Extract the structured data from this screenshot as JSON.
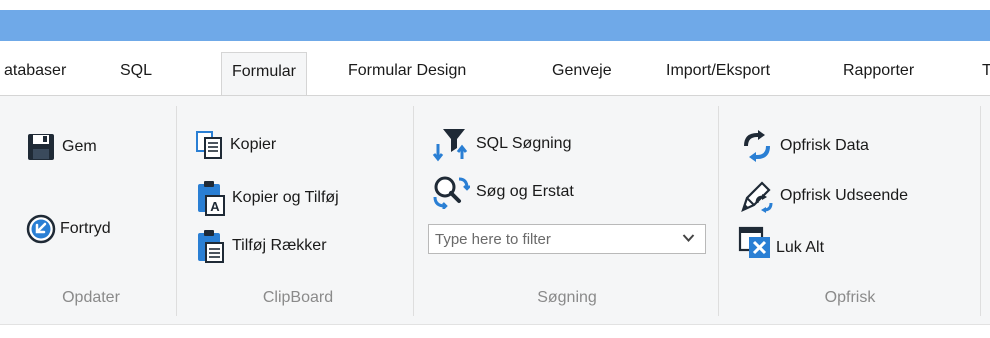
{
  "tabs": [
    "atabaser",
    "SQL",
    "Formular",
    "Formular Design",
    "Genveje",
    "Import/Eksport",
    "Rapporter",
    "T"
  ],
  "groups": {
    "opdater": {
      "label": "Opdater",
      "gem": "Gem",
      "fortryd": "Fortryd"
    },
    "clipboard": {
      "label": "ClipBoard",
      "kopier": "Kopier",
      "kopier_tilfoej": "Kopier og Tilføj",
      "tilfoej_raekker": "Tilføj Rækker"
    },
    "soegning": {
      "label": "Søgning",
      "sql_soegning": "SQL Søgning",
      "soeg_erstat": "Søg og Erstat",
      "filter_placeholder": "Type here to filter"
    },
    "opfrisk": {
      "label": "Opfrisk",
      "opfrisk_data": "Opfrisk Data",
      "opfrisk_udseende": "Opfrisk Udseende",
      "luk_alt": "Luk Alt"
    }
  },
  "colors": {
    "title_bar": "#6fa9e8",
    "ribbon_bg": "#f5f6f7",
    "accent_blue": "#2a7fd4"
  },
  "icons": [
    "save-icon",
    "undo-icon",
    "copy-icon",
    "paste-append-icon",
    "paste-rows-icon",
    "sql-filter-icon",
    "find-replace-icon",
    "refresh-data-icon",
    "refresh-appearance-icon",
    "close-all-icon"
  ]
}
